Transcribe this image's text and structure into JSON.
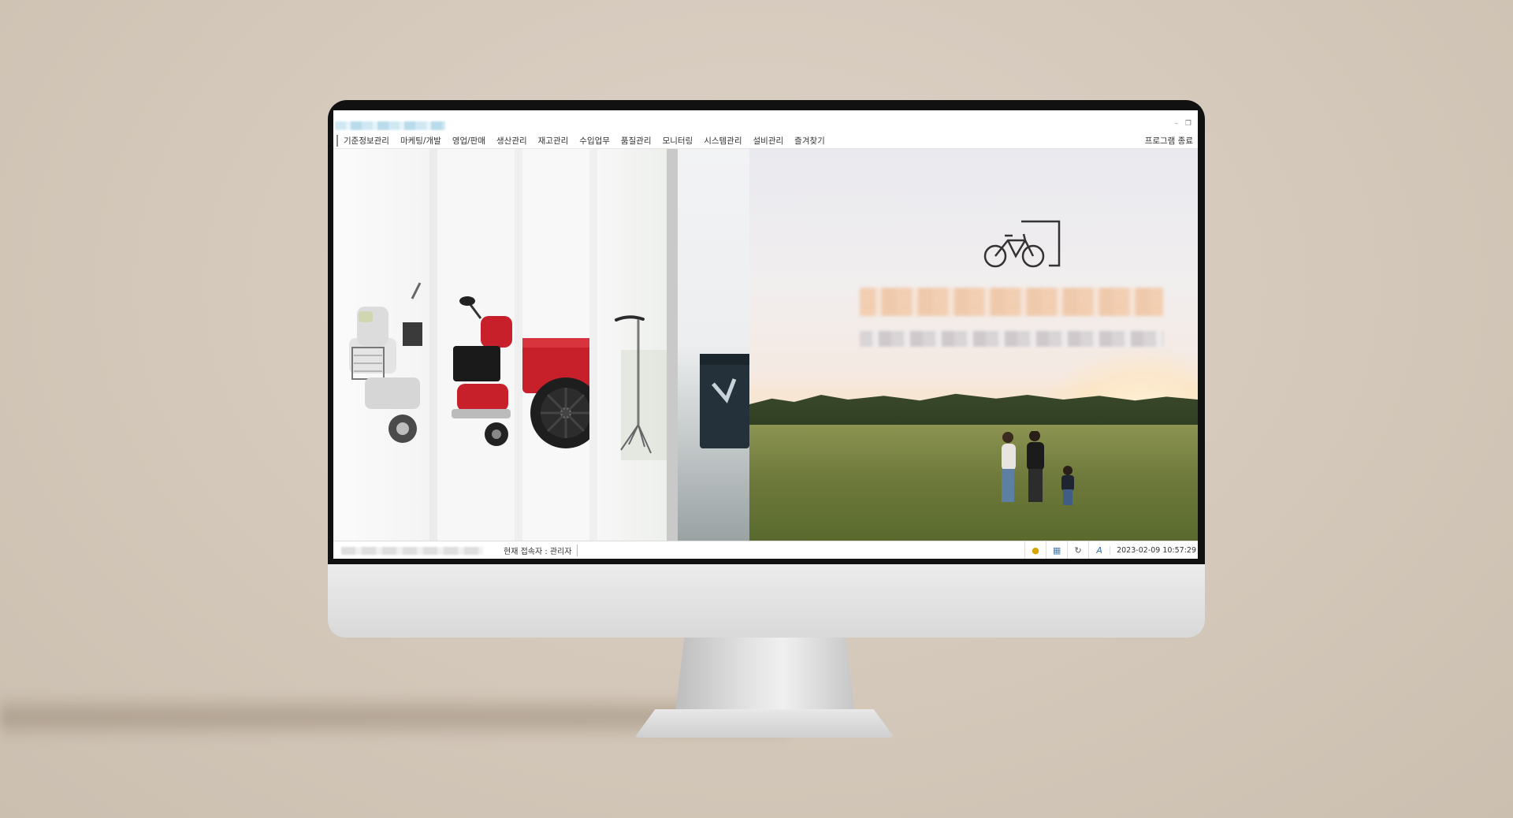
{
  "window": {
    "controls": {
      "minimize": "–",
      "restore": "❐"
    }
  },
  "menu": {
    "items": [
      "기준정보관리",
      "마케팅/개발",
      "영업/판매",
      "생산관리",
      "재고관리",
      "수입업무",
      "품질관리",
      "모니터링",
      "시스템관리",
      "설비관리",
      "즐겨찾기"
    ],
    "exit_label": "프로그램 종료"
  },
  "status": {
    "current_user": "현재 접속자 : 관리자",
    "datetime": "2023-02-09 10:57:29",
    "icons": [
      "bell-icon",
      "keyboard-icon",
      "refresh-icon",
      "spellcheck-icon"
    ]
  },
  "colors": {
    "accent_red": "#c8202b",
    "menu_text": "#333333"
  }
}
